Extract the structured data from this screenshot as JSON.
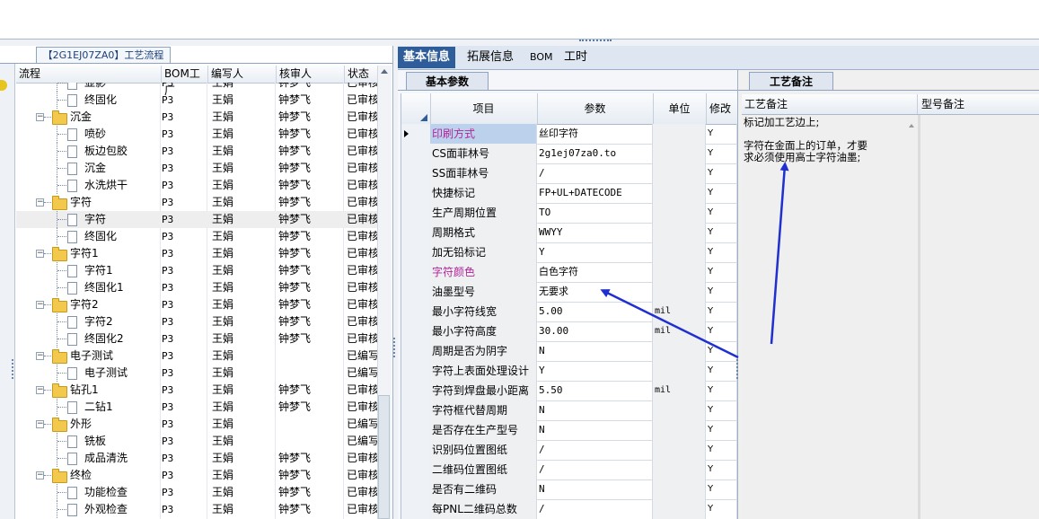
{
  "left_panel": {
    "tab_title": "【2G1EJ07ZA0】工艺流程",
    "columns": [
      "流程",
      "BOM工厂",
      "编写人",
      "核审人",
      "状态"
    ],
    "rows": [
      {
        "label": "显影",
        "level": 2,
        "kind": "doc",
        "bom": "P3",
        "writer": "王娟",
        "reviewer": "钟梦飞",
        "status": "已审核"
      },
      {
        "label": "终固化",
        "level": 2,
        "kind": "doc",
        "bom": "P3",
        "writer": "王娟",
        "reviewer": "钟梦飞",
        "status": "已审核"
      },
      {
        "label": "沉金",
        "level": 1,
        "kind": "folder",
        "bom": "P3",
        "writer": "王娟",
        "reviewer": "钟梦飞",
        "status": "已审核"
      },
      {
        "label": "喷砂",
        "level": 2,
        "kind": "doc",
        "bom": "P3",
        "writer": "王娟",
        "reviewer": "钟梦飞",
        "status": "已审核"
      },
      {
        "label": "板边包胶",
        "level": 2,
        "kind": "doc",
        "bom": "P3",
        "writer": "王娟",
        "reviewer": "钟梦飞",
        "status": "已审核"
      },
      {
        "label": "沉金",
        "level": 2,
        "kind": "doc",
        "bom": "P3",
        "writer": "王娟",
        "reviewer": "钟梦飞",
        "status": "已审核"
      },
      {
        "label": "水洗烘干",
        "level": 2,
        "kind": "doc",
        "bom": "P3",
        "writer": "王娟",
        "reviewer": "钟梦飞",
        "status": "已审核"
      },
      {
        "label": "字符",
        "level": 1,
        "kind": "folder",
        "bom": "P3",
        "writer": "王娟",
        "reviewer": "钟梦飞",
        "status": "已审核"
      },
      {
        "label": "字符",
        "level": 2,
        "kind": "doc",
        "bom": "P3",
        "writer": "王娟",
        "reviewer": "钟梦飞",
        "status": "已审核",
        "selected": true
      },
      {
        "label": "终固化",
        "level": 2,
        "kind": "doc",
        "bom": "P3",
        "writer": "王娟",
        "reviewer": "钟梦飞",
        "status": "已审核"
      },
      {
        "label": "字符1",
        "level": 1,
        "kind": "folder",
        "bom": "P3",
        "writer": "王娟",
        "reviewer": "钟梦飞",
        "status": "已审核"
      },
      {
        "label": "字符1",
        "level": 2,
        "kind": "doc",
        "bom": "P3",
        "writer": "王娟",
        "reviewer": "钟梦飞",
        "status": "已审核"
      },
      {
        "label": "终固化1",
        "level": 2,
        "kind": "doc",
        "bom": "P3",
        "writer": "王娟",
        "reviewer": "钟梦飞",
        "status": "已审核"
      },
      {
        "label": "字符2",
        "level": 1,
        "kind": "folder",
        "bom": "P3",
        "writer": "王娟",
        "reviewer": "钟梦飞",
        "status": "已审核"
      },
      {
        "label": "字符2",
        "level": 2,
        "kind": "doc",
        "bom": "P3",
        "writer": "王娟",
        "reviewer": "钟梦飞",
        "status": "已审核"
      },
      {
        "label": "终固化2",
        "level": 2,
        "kind": "doc",
        "bom": "P3",
        "writer": "王娟",
        "reviewer": "钟梦飞",
        "status": "已审核"
      },
      {
        "label": "电子测试",
        "level": 1,
        "kind": "folder",
        "bom": "P3",
        "writer": "王娟",
        "reviewer": "",
        "status": "已编写"
      },
      {
        "label": "电子测试",
        "level": 2,
        "kind": "doc",
        "bom": "P3",
        "writer": "王娟",
        "reviewer": "",
        "status": "已编写"
      },
      {
        "label": "钻孔1",
        "level": 1,
        "kind": "folder",
        "bom": "P3",
        "writer": "王娟",
        "reviewer": "钟梦飞",
        "status": "已审核"
      },
      {
        "label": "二钻1",
        "level": 2,
        "kind": "doc",
        "bom": "P3",
        "writer": "王娟",
        "reviewer": "钟梦飞",
        "status": "已审核"
      },
      {
        "label": "外形",
        "level": 1,
        "kind": "folder",
        "bom": "P3",
        "writer": "王娟",
        "reviewer": "",
        "status": "已编写"
      },
      {
        "label": "铣板",
        "level": 2,
        "kind": "doc",
        "bom": "P3",
        "writer": "王娟",
        "reviewer": "",
        "status": "已编写"
      },
      {
        "label": "成品清洗",
        "level": 2,
        "kind": "doc",
        "bom": "P3",
        "writer": "王娟",
        "reviewer": "钟梦飞",
        "status": "已审核"
      },
      {
        "label": "终检",
        "level": 1,
        "kind": "folder",
        "bom": "P3",
        "writer": "王娟",
        "reviewer": "钟梦飞",
        "status": "已审核"
      },
      {
        "label": "功能检查",
        "level": 2,
        "kind": "doc",
        "bom": "P3",
        "writer": "王娟",
        "reviewer": "钟梦飞",
        "status": "已审核"
      },
      {
        "label": "外观检查",
        "level": 2,
        "kind": "doc",
        "bom": "P3",
        "writer": "王娟",
        "reviewer": "钟梦飞",
        "status": "已审核"
      }
    ]
  },
  "main_tabs": [
    "基本信息",
    "拓展信息",
    "BOM",
    "工时"
  ],
  "basic_params": {
    "subtab": "基本参数",
    "columns": [
      "项目",
      "参数",
      "单位",
      "修改"
    ],
    "rows": [
      {
        "name": "印刷方式",
        "value": "丝印字符",
        "unit": "",
        "mod": "Y",
        "magenta": true,
        "current": true
      },
      {
        "name": "CS面菲林号",
        "value": "2g1ej07za0.to",
        "unit": "",
        "mod": "Y"
      },
      {
        "name": "SS面菲林号",
        "value": "/",
        "unit": "",
        "mod": "Y"
      },
      {
        "name": "快捷标记",
        "value": "FP+UL+DATECODE",
        "unit": "",
        "mod": "Y"
      },
      {
        "name": "生产周期位置",
        "value": "TO",
        "unit": "",
        "mod": "Y"
      },
      {
        "name": "周期格式",
        "value": "WWYY",
        "unit": "",
        "mod": "Y"
      },
      {
        "name": "加无铅标记",
        "value": "Y",
        "unit": "",
        "mod": "Y"
      },
      {
        "name": "字符颜色",
        "value": "白色字符",
        "unit": "",
        "mod": "Y",
        "magenta": true
      },
      {
        "name": "油墨型号",
        "value": "无要求",
        "unit": "",
        "mod": "Y"
      },
      {
        "name": "最小字符线宽",
        "value": "5.00",
        "unit": "mil",
        "mod": "Y"
      },
      {
        "name": "最小字符高度",
        "value": "30.00",
        "unit": "mil",
        "mod": "Y"
      },
      {
        "name": "周期是否为阴字",
        "value": "N",
        "unit": "",
        "mod": "Y"
      },
      {
        "name": "字符上表面处理设计",
        "value": "Y",
        "unit": "",
        "mod": "Y"
      },
      {
        "name": "字符到焊盘最小距离",
        "value": "5.50",
        "unit": "mil",
        "mod": "Y"
      },
      {
        "name": "字符框代替周期",
        "value": "N",
        "unit": "",
        "mod": "Y"
      },
      {
        "name": "是否存在生产型号",
        "value": "N",
        "unit": "",
        "mod": "Y"
      },
      {
        "name": "识别码位置图纸",
        "value": "/",
        "unit": "",
        "mod": "Y"
      },
      {
        "name": "二维码位置图纸",
        "value": "/",
        "unit": "",
        "mod": "Y"
      },
      {
        "name": "是否有二维码",
        "value": "N",
        "unit": "",
        "mod": "Y"
      },
      {
        "name": "每PNL二维码总数",
        "value": "/",
        "unit": "",
        "mod": "Y"
      }
    ]
  },
  "notes": {
    "tab": "工艺备注",
    "craft_header": "工艺备注",
    "model_header": "型号备注",
    "craft_line1": "标记加工艺边上;",
    "craft_line2": "字符在金面上的订单，才要求必须使用高士字符油墨;"
  },
  "colors": {
    "accent": "#2f5d9a",
    "magenta": "#b0269a",
    "arrow": "#1f2fd0"
  }
}
